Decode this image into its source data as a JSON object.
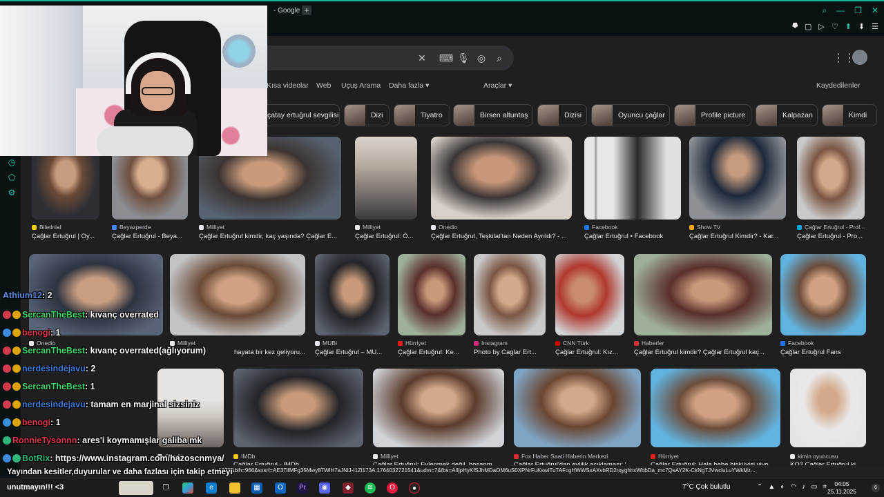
{
  "browser": {
    "tab_title": "- Google",
    "tab_add": "+",
    "window_controls": [
      "⌕",
      "—",
      "❐",
      "✕"
    ],
    "toolbar_icons": [
      "⯂",
      "▢",
      "▷",
      "♡",
      "⬆",
      "⬇",
      "☰"
    ]
  },
  "leftbar": {
    "icons": [
      "clock-icon",
      "leaf-icon",
      "settings-icon"
    ]
  },
  "search": {
    "clear_icon": "✕",
    "keyboard_icon": "⌨",
    "mic_icon": "🎙",
    "lens_icon": "◎",
    "search_icon": "⌕",
    "apps_icon": "⋮⋮"
  },
  "filters": {
    "items": [
      "Kısa videolar",
      "Web",
      "Uçuş Arama",
      "Daha fazla ▾"
    ],
    "tools": "Araçlar ▾",
    "saved": "Kaydedilenler"
  },
  "chips": [
    "çatay ertuğrul sevgilisi",
    "Dizi",
    "Tiyatro",
    "Birsen altuntaş",
    "Dizisi",
    "Oyuncu çağlar",
    "Profile picture",
    "Kalpazan",
    "Kimdi"
  ],
  "results": {
    "row1": [
      {
        "source": "Biletinial",
        "title": "Çağlar Ertuğrul | Oy..."
      },
      {
        "source": "Beyazperde",
        "title": "Çağlar Ertuğrul - Beya..."
      },
      {
        "source": "Milliyet",
        "title": "Çağlar Ertuğrul kimdir, kaç yaşında? Çağlar E..."
      },
      {
        "source": "Milliyet",
        "title": "Çağlar Ertuğrul: Ö..."
      },
      {
        "source": "Onedio",
        "title": "Çağlar Ertuğrul, Teşkilat'tan Neden Ayrıldı? - ..."
      },
      {
        "source": "Facebook",
        "title": "Çağlar Ertuğrul • Facebook"
      },
      {
        "source": "Show TV",
        "title": "Çağlar Ertuğrul Kimdir? - Kar..."
      },
      {
        "source": "Çağlar Ertuğrul - Prof...",
        "title": "Çağlar Ertuğrul - Pro..."
      }
    ],
    "row2": [
      {
        "source": "Onedio",
        "title": ""
      },
      {
        "source": "Milliyet",
        "title": "hayata bir kez geliyoru..."
      },
      {
        "source": "MUBI",
        "title": "Çağlar Ertuğrul – MU..."
      },
      {
        "source": "Hürriyet",
        "title": "Çağlar Ertuğrul: Ke..."
      },
      {
        "source": "Instagram",
        "title": "Photo by Caglar Ert..."
      },
      {
        "source": "CNN Türk",
        "title": "Çağlar Ertuğrul: Kız..."
      },
      {
        "source": "Haberler",
        "title": "Çağlar Ertuğrul kimdir? Çağlar Ertuğrul kaç..."
      },
      {
        "source": "Facebook",
        "title": "Çağlar Ertuğrul Fans"
      }
    ],
    "row3": [
      {
        "source": "Onedio",
        "title": ""
      },
      {
        "source": "IMDb",
        "title": "Çağlar Ertuğrul - IMDb"
      },
      {
        "source": "Milliyet",
        "title": "Çağlar Ertuğrul: Evlenmek değil, boşanm..."
      },
      {
        "source": "Fox Haber Saati Haberin Merkezi",
        "title": "Çağlar Ertuğrul'dan evlilik açıklaması: '..."
      },
      {
        "source": "Hürriyet",
        "title": "Çağlar Ertuğrul: Hala bebe bisküvisi yiyo..."
      },
      {
        "source": "kimin oyuncusu",
        "title": "KO? Çağlar Ertuğrul ki..."
      }
    ]
  },
  "status_url": "w=1875&bih=966&sxsrf=AE3TifMFg35Mwy87WlH7aJNlJ-I1Zl173A:1764032721541&udm=7&fbs=AIIjpHyKfSJhMDaOM6uS0XPNrFuKswITuTAFcgHWWSxAXvbRD2rqyghhxWbbDa_mc7QsAY2K-CkNgTJVwcluLuYWkMz...",
  "chat": [
    {
      "user": "Athium12",
      "user_color": "#5b8be0",
      "message": ": 2",
      "badges": []
    },
    {
      "user": "SercanTheBest",
      "user_color": "#3ed96a",
      "message": ": kıvanç overrated",
      "badges": [
        "red",
        "gold"
      ]
    },
    {
      "user": "benogi",
      "user_color": "#e0364e",
      "message": ": 1",
      "badges": [
        "blue",
        "gold"
      ]
    },
    {
      "user": "SercanTheBest",
      "user_color": "#3ed96a",
      "message": ": kıvanç overrated(ağlıyorum)",
      "badges": [
        "red",
        "gold"
      ]
    },
    {
      "user": "nerdesindejavu",
      "user_color": "#3f7ddb",
      "message": ": 2",
      "badges": [
        "red",
        "gold"
      ]
    },
    {
      "user": "SercanTheBest",
      "user_color": "#3ed96a",
      "message": ": 1",
      "badges": [
        "red",
        "gold"
      ]
    },
    {
      "user": "nerdesindejavu",
      "user_color": "#3f7ddb",
      "message": ": tamam en marjinal sizsiniz",
      "badges": [
        "red",
        "gold"
      ]
    },
    {
      "user": "benogi",
      "user_color": "#e0364e",
      "message": ": 1",
      "badges": [
        "blue",
        "gold"
      ]
    },
    {
      "user": "RonnieTysonnn",
      "user_color": "#e0364e",
      "message": ": ares'i koymamışlar galiba mk",
      "badges": [
        "green"
      ]
    },
    {
      "user": "BotRix",
      "user_color": "#2fb67d",
      "message": ": https://www.instagram.com/hazoscnmya/",
      "badges": [
        "blue",
        "green"
      ]
    }
  ],
  "follow_banner": "Yayından kesitler,duyurular ve daha fazlası için takip etmeyi",
  "taskbar": {
    "left_text": "unutmayın!!! <3",
    "weather": "7°C  Çok bulutlu",
    "time": "04:05",
    "date": "25.11.2025",
    "notification_count": "6"
  },
  "colors": {
    "accent": "#21c6a7",
    "background": "#1f1f1f"
  }
}
